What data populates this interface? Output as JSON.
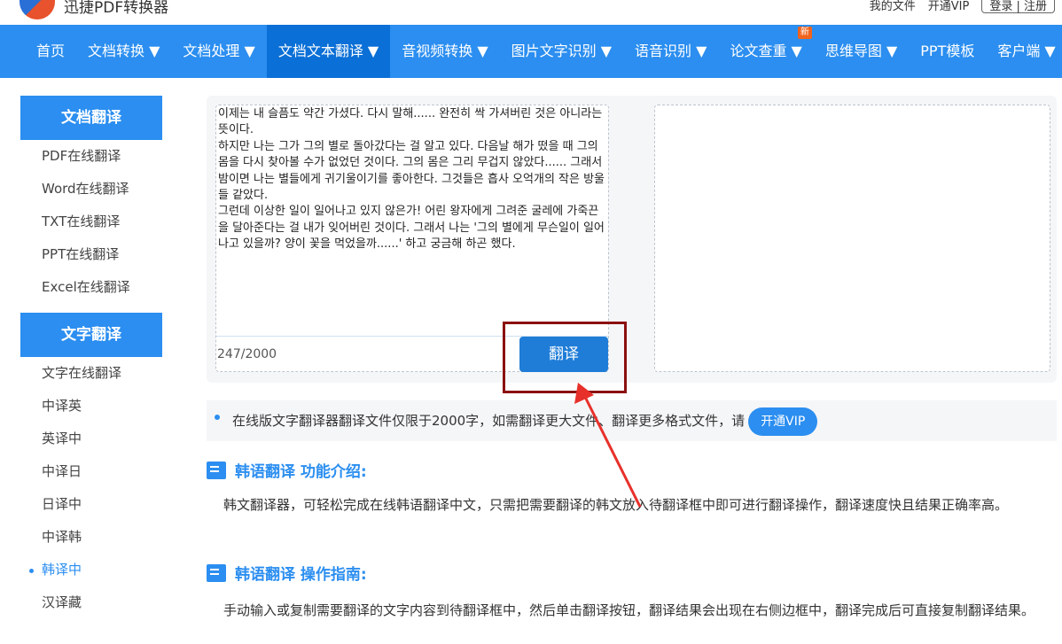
{
  "header": {
    "brand": "迅捷PDF转换器",
    "my_files": "我的文件",
    "vip": "开通VIP",
    "login": "登录",
    "register": "注册"
  },
  "nav": [
    {
      "label": "首页"
    },
    {
      "label": "文档转换 ▼"
    },
    {
      "label": "文档处理 ▼"
    },
    {
      "label": "文档文本翻译 ▼"
    },
    {
      "label": "音视频转换 ▼"
    },
    {
      "label": "图片文字识别 ▼"
    },
    {
      "label": "语音识别 ▼"
    },
    {
      "label": "论文查重 ▼",
      "badge": "新"
    },
    {
      "label": "思维导图 ▼"
    },
    {
      "label": "PPT模板"
    },
    {
      "label": "客户端 ▼"
    }
  ],
  "sidebar": {
    "doc_title": "文档翻译",
    "doc_items": [
      "PDF在线翻译",
      "Word在线翻译",
      "TXT在线翻译",
      "PPT在线翻译",
      "Excel在线翻译"
    ],
    "text_title": "文字翻译",
    "text_items": [
      "文字在线翻译",
      "中译英",
      "英译中",
      "中译日",
      "日译中",
      "中译韩",
      "韩译中",
      "汉译藏"
    ]
  },
  "translator": {
    "input": "이제는 내 슬픔도 약간 가셨다. 다시 말해...... 완전히 싹 가셔버린 것은 아니라는 뜻이다.\n하지만 나는 그가 그의 별로 돌아갔다는 걸 알고 있다. 다음날 해가 떴을 때 그의 몸을 다시 찾아볼 수가 없었던 것이다. 그의 몸은 그리 무겁지 않았다...... 그래서 밤이면 나는 별들에게 귀기울이기를 좋아한다. 그것들은 흡사 오억개의 작은 방울들 같았다.\n그런데 이상한 일이 일어나고 있지 않은가! 어린 왕자에게 그려준 굴레에 가죽끈을 달아준다는 걸 내가 잊어버린 것이다. 그래서 나는 '그의 별에게 무슨일이 일어나고 있을까? 양이 꽃을 먹었을까......' 하고 궁금해 하곤 했다.",
    "count": "247",
    "max": "/2000",
    "button": "翻译"
  },
  "notice": {
    "text": "在线版文字翻译器翻译文件仅限于2000字，如需翻译更大文件、翻译更多格式文件，请",
    "vip_button": "开通VIP"
  },
  "sections": [
    {
      "title": "韩语翻译 功能介绍:",
      "body": "韩文翻译器，可轻松完成在线韩语翻译中文，只需把需要翻译的韩文放入待翻译框中即可进行翻译操作，翻译速度快且结果正确率高。"
    },
    {
      "title": "韩语翻译 操作指南:",
      "body": "手动输入或复制需要翻译的文字内容到待翻译框中，然后单击翻译按钮，翻译结果会出现在右侧边框中，翻译完成后可直接复制翻译结果。"
    }
  ]
}
